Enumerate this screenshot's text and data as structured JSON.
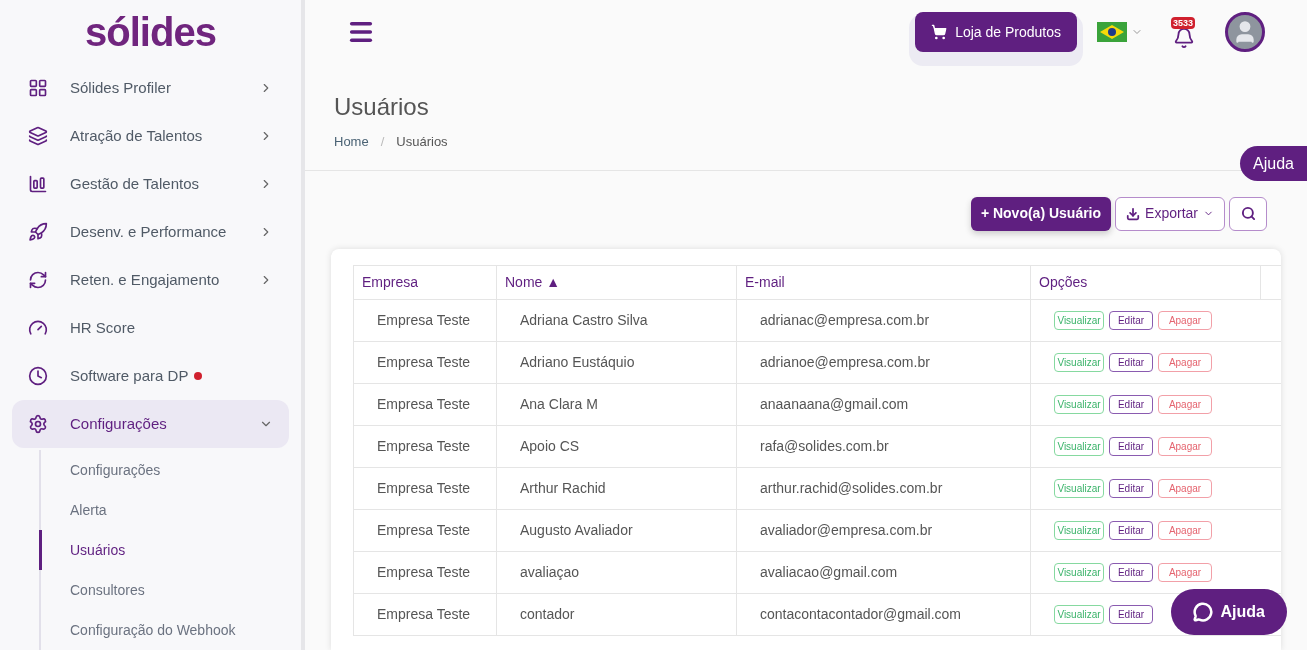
{
  "logo": "sólides",
  "sidebar": {
    "items": [
      {
        "label": "Sólides Profiler",
        "kind": "group",
        "expanded": false,
        "selected": false
      },
      {
        "label": "Atração de Talentos",
        "kind": "group",
        "expanded": false,
        "selected": false
      },
      {
        "label": "Gestão de Talentos",
        "kind": "group",
        "expanded": false,
        "selected": false
      },
      {
        "label": "Desenv. e Performance",
        "kind": "group",
        "expanded": false,
        "selected": false
      },
      {
        "label": "Reten. e Engajamento",
        "kind": "group",
        "expanded": false,
        "selected": false
      },
      {
        "label": "HR Score",
        "kind": "link",
        "selected": false
      },
      {
        "label": "Software para DP",
        "kind": "link",
        "selected": false,
        "new_dot": true
      },
      {
        "label": "Configurações",
        "kind": "group",
        "expanded": true,
        "selected": true,
        "children": [
          {
            "label": "Configurações",
            "selected": false
          },
          {
            "label": "Alerta",
            "selected": false
          },
          {
            "label": "Usuários",
            "selected": true
          },
          {
            "label": "Consultores",
            "selected": false
          },
          {
            "label": "Configuração do Webhook",
            "selected": false
          }
        ]
      }
    ]
  },
  "header": {
    "store_button": "Loja de Produtos",
    "notification_count": "3533"
  },
  "page": {
    "title": "Usuários",
    "breadcrumb": [
      "Home",
      "Usuários"
    ],
    "breadcrumb_separator": "/",
    "help_tab": "Ajuda"
  },
  "toolbar": {
    "new_button": "+ Novo(a) Usuário",
    "export_button": "Exportar"
  },
  "table": {
    "columns": [
      "Empresa",
      "Nome ▲",
      "E-mail",
      "Opções"
    ],
    "rows": [
      {
        "cells": [
          "Empresa Teste",
          "Adriana Castro Silva",
          "adrianac@empresa.com.br"
        ],
        "actions": [
          {
            "label": "Visualizar",
            "kind": "view"
          },
          {
            "label": "Editar",
            "kind": "edit"
          },
          {
            "label": "Apagar",
            "kind": "delete"
          }
        ]
      },
      {
        "cells": [
          "Empresa Teste",
          "Adriano Eustáquio",
          "adrianoe@empresa.com.br"
        ],
        "actions": [
          {
            "label": "Visualizar",
            "kind": "view"
          },
          {
            "label": "Editar",
            "kind": "edit"
          },
          {
            "label": "Apagar",
            "kind": "delete"
          }
        ]
      },
      {
        "cells": [
          "Empresa Teste",
          "Ana Clara M",
          "anaanaana@gmail.com"
        ],
        "actions": [
          {
            "label": "Visualizar",
            "kind": "view"
          },
          {
            "label": "Editar",
            "kind": "edit"
          },
          {
            "label": "Apagar",
            "kind": "delete"
          }
        ]
      },
      {
        "cells": [
          "Empresa Teste",
          "Apoio CS",
          "rafa@solides.com.br"
        ],
        "actions": [
          {
            "label": "Visualizar",
            "kind": "view"
          },
          {
            "label": "Editar",
            "kind": "edit"
          },
          {
            "label": "Apagar",
            "kind": "delete"
          }
        ]
      },
      {
        "cells": [
          "Empresa Teste",
          "Arthur Rachid",
          "arthur.rachid@solides.com.br"
        ],
        "actions": [
          {
            "label": "Visualizar",
            "kind": "view"
          },
          {
            "label": "Editar",
            "kind": "edit"
          },
          {
            "label": "Apagar",
            "kind": "delete"
          }
        ]
      },
      {
        "cells": [
          "Empresa Teste",
          "Augusto Avaliador",
          "avaliador@empresa.com.br"
        ],
        "actions": [
          {
            "label": "Visualizar",
            "kind": "view"
          },
          {
            "label": "Editar",
            "kind": "edit"
          },
          {
            "label": "Apagar",
            "kind": "delete"
          }
        ]
      },
      {
        "cells": [
          "Empresa Teste",
          "avaliaçao",
          "avaliacao@gmail.com"
        ],
        "actions": [
          {
            "label": "Visualizar",
            "kind": "view"
          },
          {
            "label": "Editar",
            "kind": "edit"
          },
          {
            "label": "Apagar",
            "kind": "delete"
          }
        ]
      },
      {
        "cells": [
          "Empresa Teste",
          "contador",
          "contacontacontador@gmail.com"
        ],
        "actions": [
          {
            "label": "Visualizar",
            "kind": "view"
          },
          {
            "label": "Editar",
            "kind": "edit"
          }
        ]
      }
    ]
  },
  "help_button": "Ajuda"
}
